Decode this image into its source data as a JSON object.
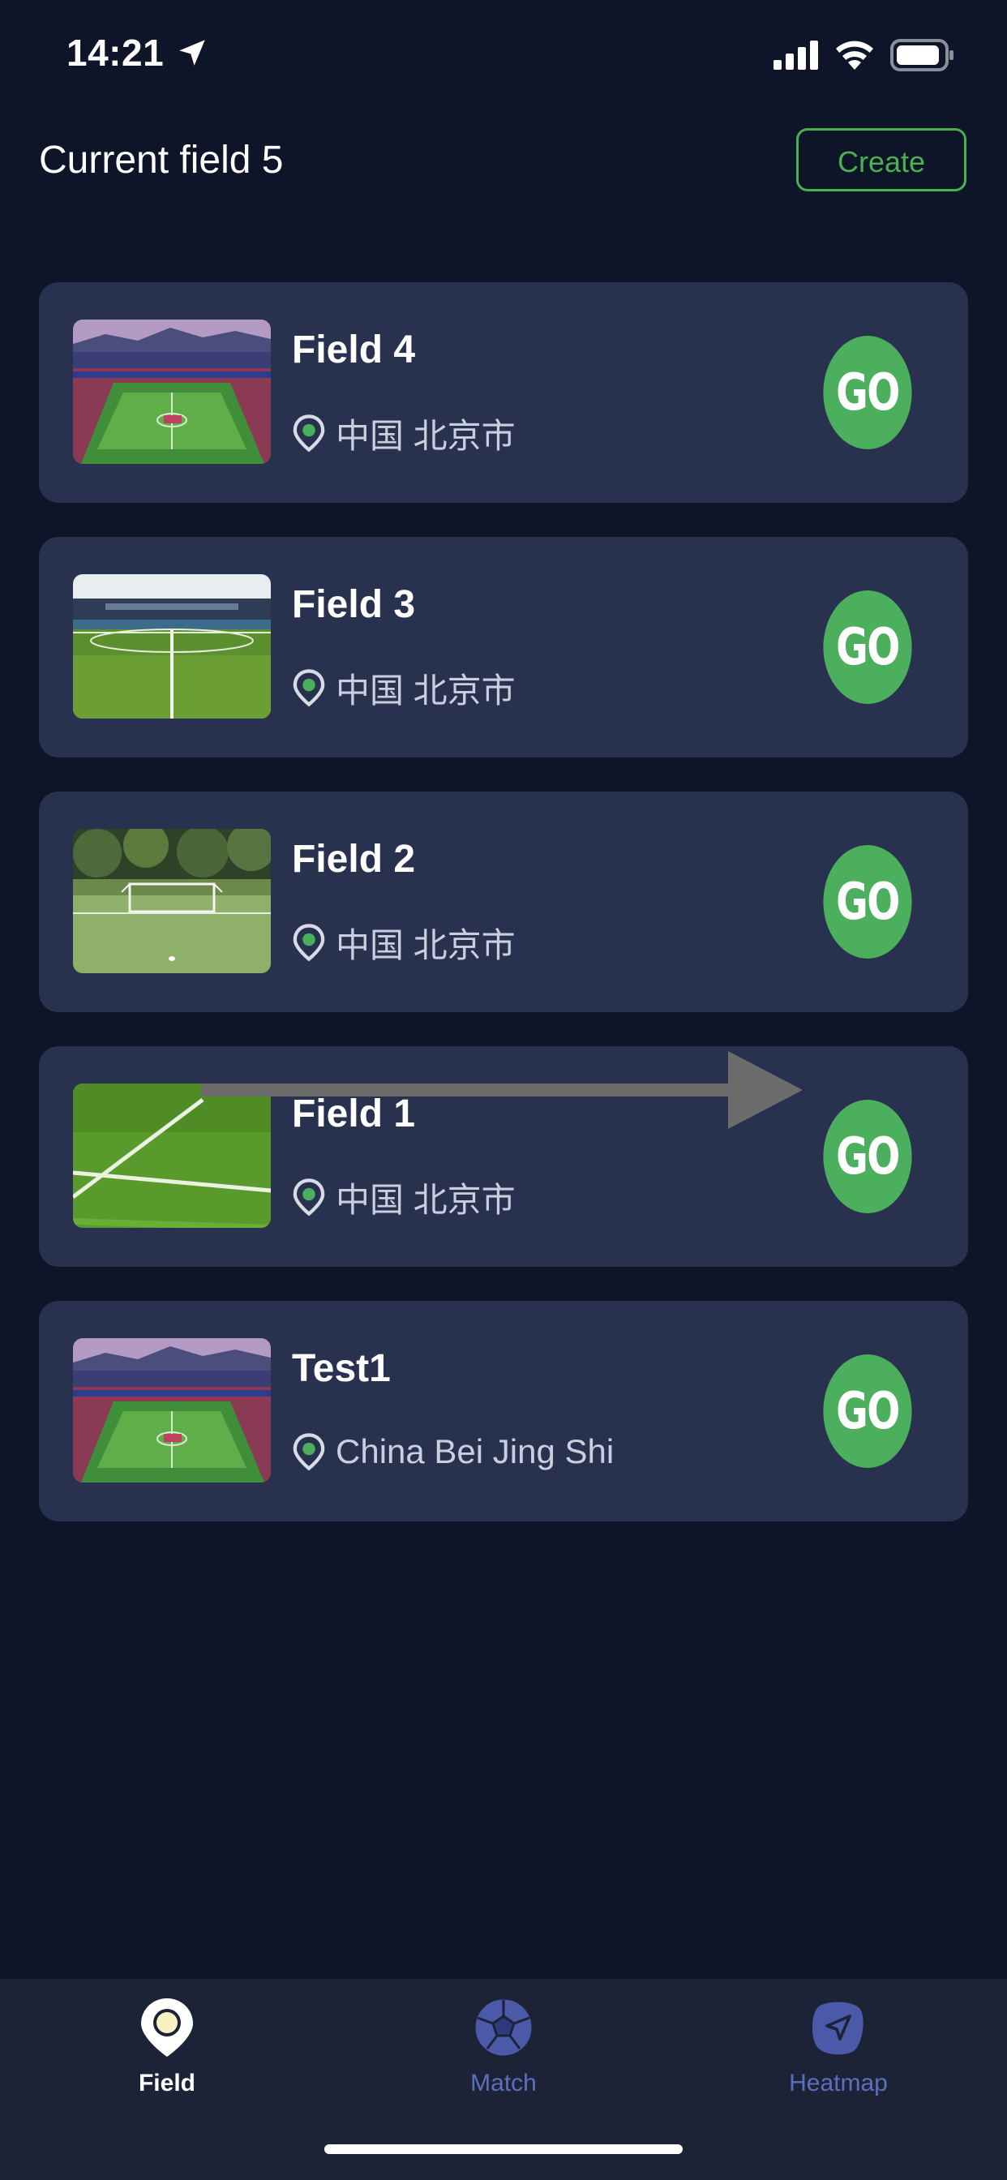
{
  "status_bar": {
    "time": "14:21",
    "icons": [
      "location-arrow-icon",
      "signal-icon",
      "wifi-icon",
      "battery-icon"
    ]
  },
  "header": {
    "title": "Current field 5",
    "create_label": "Create"
  },
  "fields": [
    {
      "name": "Field 4",
      "location": "中国 北京市",
      "go_label": "GO",
      "thumbnail": "stadium-aerial"
    },
    {
      "name": "Field 3",
      "location": "中国 北京市",
      "go_label": "GO",
      "thumbnail": "stadium-pitch"
    },
    {
      "name": "Field 2",
      "location": "中国 北京市",
      "go_label": "GO",
      "thumbnail": "goal-field"
    },
    {
      "name": "Field 1",
      "location": "中国 北京市",
      "go_label": "GO",
      "thumbnail": "turf-lines"
    },
    {
      "name": "Test1",
      "location": "China Bei Jing Shi",
      "go_label": "GO",
      "thumbnail": "stadium-aerial"
    }
  ],
  "tabs": [
    {
      "label": "Field",
      "icon": "location-pin-icon",
      "active": true
    },
    {
      "label": "Match",
      "icon": "soccer-ball-icon",
      "active": false
    },
    {
      "label": "Heatmap",
      "icon": "navigation-arrow-icon",
      "active": false
    }
  ],
  "colors": {
    "background": "#0e1529",
    "card": "#28324f",
    "accent_green": "#4caf5e",
    "tab_inactive": "#5b6fbf"
  }
}
